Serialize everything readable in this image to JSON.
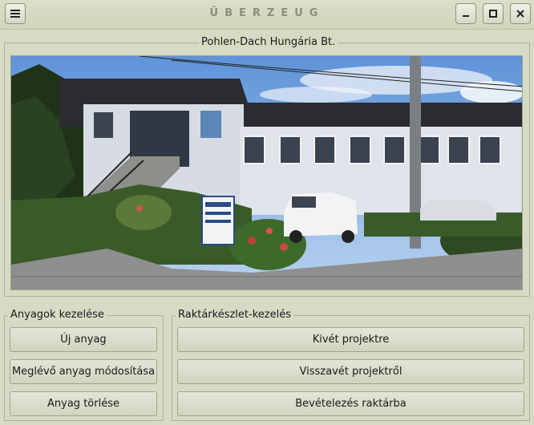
{
  "window": {
    "title": "ÜBERZEUG",
    "menu_icon": "hamburger-menu-icon",
    "minimize_icon": "minimize-icon",
    "maximize_icon": "maximize-icon",
    "close_icon": "close-icon"
  },
  "photo_frame": {
    "label": "Pohlen-Dach Hungária Bt."
  },
  "materials": {
    "label": "Anyagok kezelése",
    "buttons": [
      "Új anyag",
      "Meglévő anyag módosítása",
      "Anyag törlése"
    ]
  },
  "inventory": {
    "label": "Raktárkészlet-kezelés",
    "buttons": [
      "Kivét projektre",
      "Visszavét projektről",
      "Bevételezés raktárba"
    ]
  },
  "photo_sign_text": "Pohlen Dach"
}
